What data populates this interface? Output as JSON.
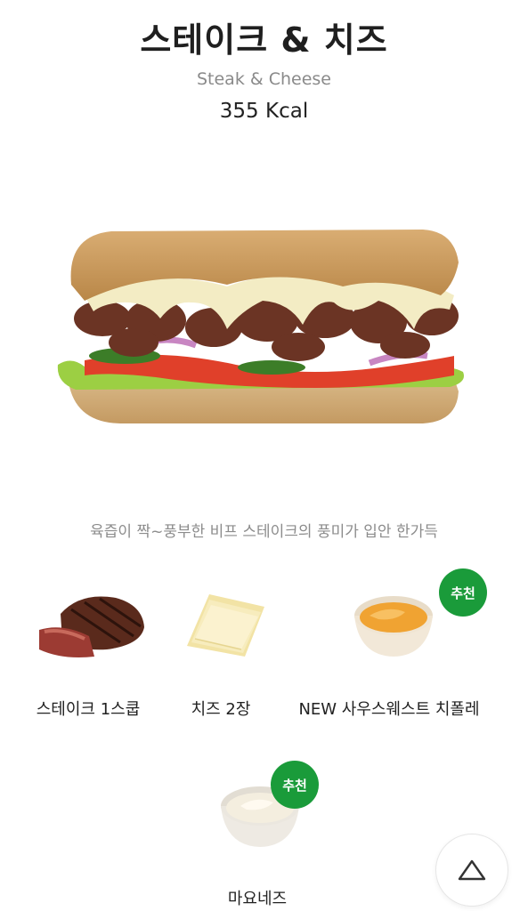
{
  "product": {
    "name_ko": "스테이크 & 치즈",
    "name_en": "Steak & Cheese",
    "calories": "355 Kcal",
    "description": "육즙이 짝~풍부한 비프 스테이크의 풍미가 입안 한가득"
  },
  "ingredients": [
    {
      "label": "스테이크 1스쿱",
      "icon": "steak-icon",
      "recommended": false
    },
    {
      "label": "치즈 2장",
      "icon": "cheese-slices-icon",
      "recommended": false
    },
    {
      "label": "NEW 사우스웨스트 치폴레",
      "icon": "chipotle-sauce-icon",
      "recommended": true,
      "badge": "추천"
    },
    {
      "label": "마요네즈",
      "icon": "mayonnaise-icon",
      "recommended": true,
      "badge": "추천"
    }
  ],
  "scroll_top": {
    "icon": "triangle-up-icon"
  },
  "colors": {
    "badge_green": "#1a9b3a",
    "title": "#1f1f1f",
    "muted": "#8a8a8a"
  }
}
